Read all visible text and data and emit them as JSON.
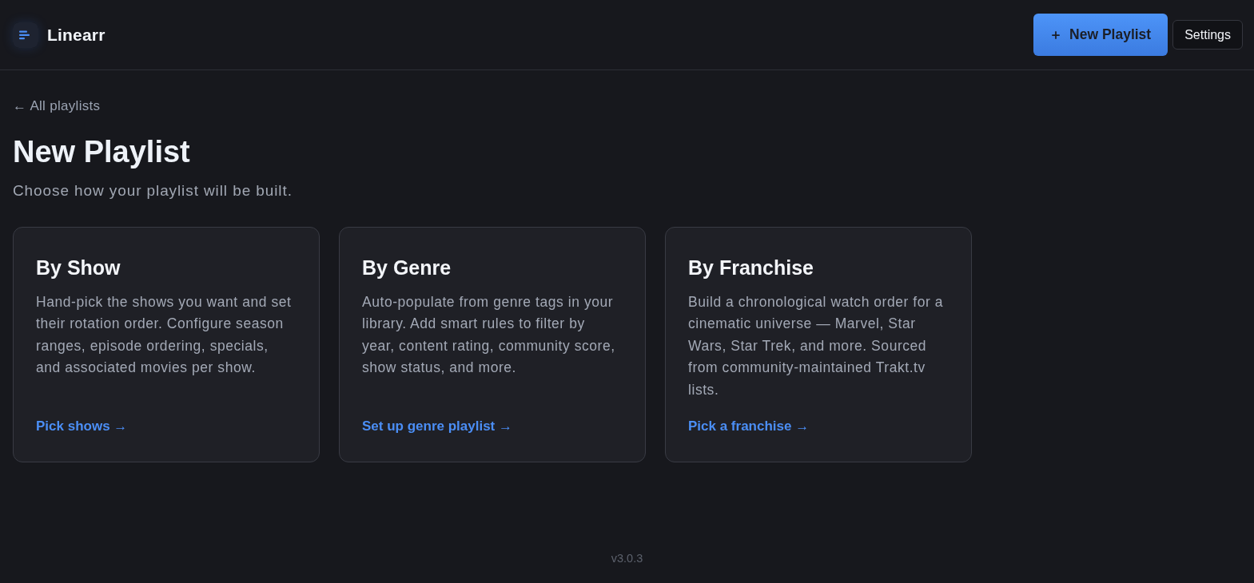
{
  "app": {
    "name": "Linearr"
  },
  "header_actions": [
    {
      "kind": "primary",
      "label": "New Playlist"
    },
    {
      "kind": "secondary",
      "label": "Settings"
    }
  ],
  "back_link": "← All playlists",
  "page": {
    "title": "New Playlist",
    "subtitle": "Choose how your playlist will be built."
  },
  "cards": [
    {
      "title": "By Show",
      "description": "Hand-pick the shows you want and set their rotation order. Configure season ranges, episode ordering, specials, and associated movies per show.",
      "link": "Pick shows →"
    },
    {
      "title": "By Genre",
      "description": "Auto-populate from genre tags in your library. Add smart rules to filter by year, content rating, community score, show status, and more.",
      "link": "Set up genre playlist →"
    },
    {
      "title": "By Franchise",
      "description": "Build a chronological watch order for a cinematic universe — Marvel, Star Wars, Star Trek, and more. Sourced from community-maintained Trakt.tv lists.",
      "link": "Pick a franchise →"
    }
  ],
  "footer": {
    "version": "v3.0.3"
  }
}
